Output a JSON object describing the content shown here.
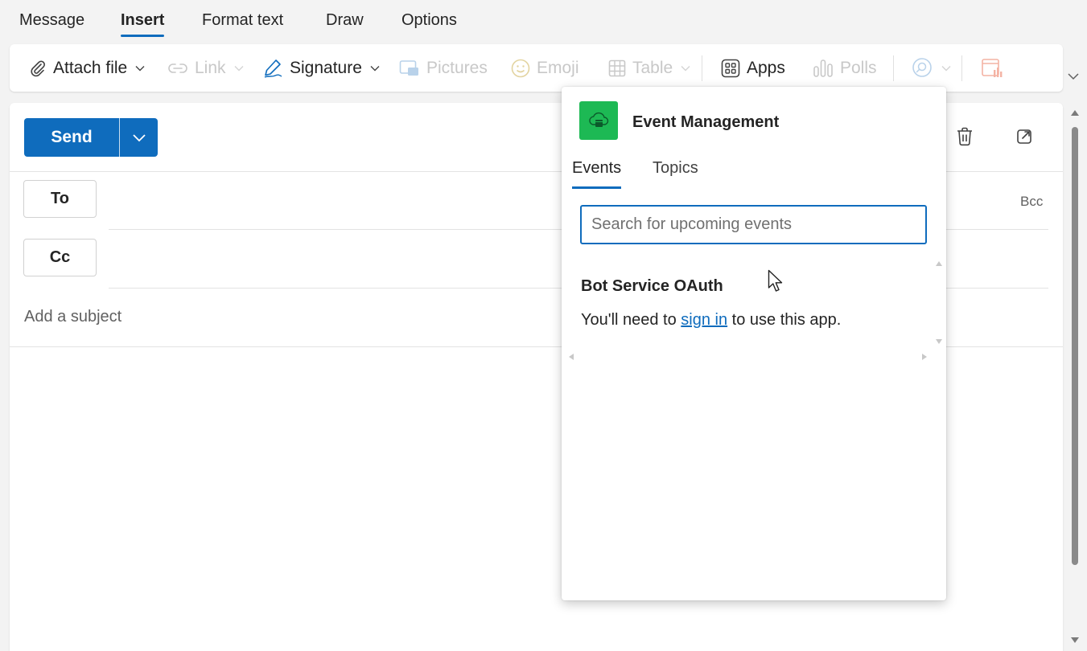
{
  "menu": {
    "tabs": [
      {
        "label": "Message"
      },
      {
        "label": "Insert"
      },
      {
        "label": "Format text"
      },
      {
        "label": "Draw"
      },
      {
        "label": "Options"
      }
    ],
    "active": "Insert"
  },
  "ribbon": {
    "attach": "Attach file",
    "link": "Link",
    "signature": "Signature",
    "pictures": "Pictures",
    "emoji": "Emoji",
    "table": "Table",
    "apps": "Apps",
    "polls": "Polls"
  },
  "compose": {
    "send": "Send",
    "to": "To",
    "cc": "Cc",
    "bcc": "Bcc",
    "subject_placeholder": "Add a subject"
  },
  "popup": {
    "app_name": "Event Management",
    "tabs": [
      {
        "label": "Events"
      },
      {
        "label": "Topics"
      }
    ],
    "active_tab": "Events",
    "search_placeholder": "Search for upcoming events",
    "auth_title": "Bot Service OAuth",
    "auth_msg_before": "You'll need to ",
    "auth_link": "sign in",
    "auth_msg_after": " to use this app."
  },
  "colors": {
    "accent": "#0f6cbd",
    "app_logo": "#1db954"
  }
}
